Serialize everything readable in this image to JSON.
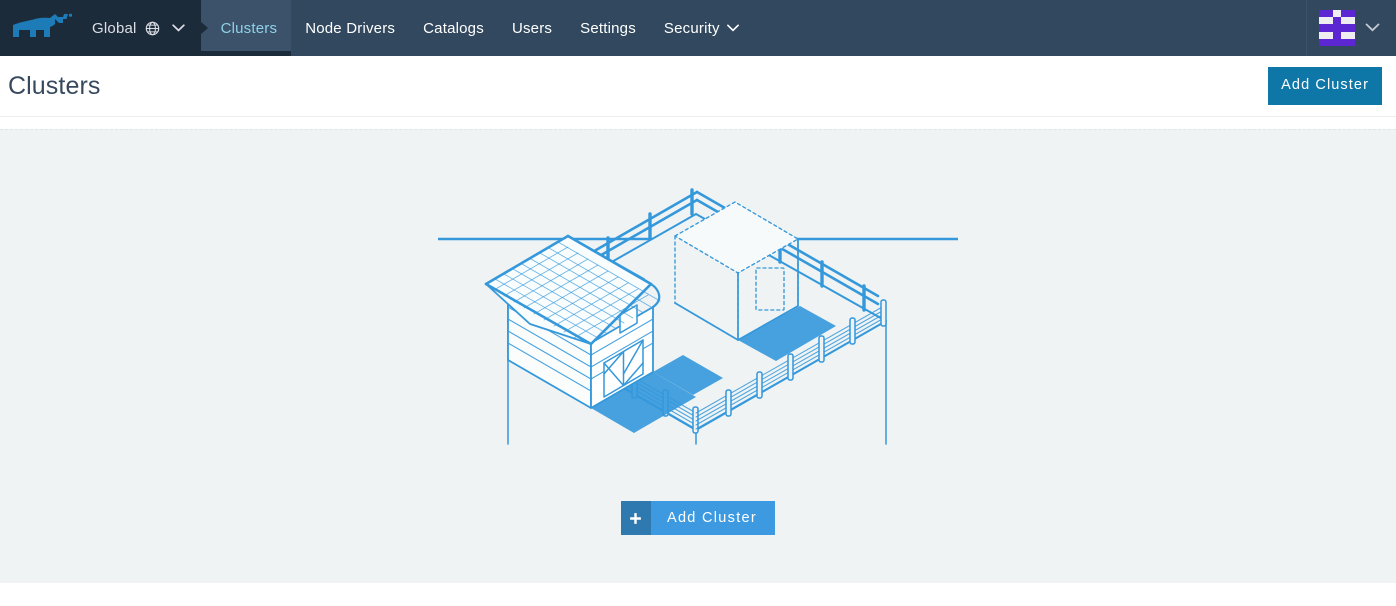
{
  "header": {
    "logo_name": "rancher-bull-logo",
    "cluster_switcher": {
      "label": "Global",
      "globe_icon": "globe-icon",
      "chevron_icon": "chevron-down-icon"
    },
    "nav_items": [
      {
        "label": "Clusters",
        "active": true,
        "has_chevron": false
      },
      {
        "label": "Node Drivers",
        "active": false,
        "has_chevron": false
      },
      {
        "label": "Catalogs",
        "active": false,
        "has_chevron": false
      },
      {
        "label": "Users",
        "active": false,
        "has_chevron": false
      },
      {
        "label": "Settings",
        "active": false,
        "has_chevron": false
      },
      {
        "label": "Security",
        "active": false,
        "has_chevron": true
      }
    ],
    "user_menu": {
      "avatar_name": "user-identicon-avatar",
      "chevron_icon": "chevron-down-icon"
    }
  },
  "page": {
    "title": "Clusters",
    "add_cluster_label": "Add Cluster"
  },
  "empty_state": {
    "illustration_name": "isometric-ranch-illustration",
    "cta": {
      "plus_icon": "plus-icon",
      "label": "Add Cluster"
    }
  },
  "colors": {
    "header_bg": "#31485e",
    "header_dark_bg": "#1c2b39",
    "nav_active_bg": "#3c526a",
    "nav_active_text": "#8fd1e8",
    "primary_button": "#0f76a8",
    "cta_button": "#3d9ae0",
    "cta_icon_box": "#2d79b0",
    "panel_bg": "#eff3f4",
    "title_text": "#37495e",
    "illustration_line": "#3498db",
    "avatar_accent": "#5c26d3"
  }
}
